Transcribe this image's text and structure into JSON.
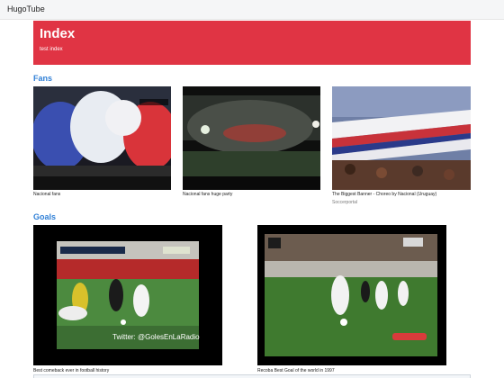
{
  "navbar": {
    "brand": "HugoTube"
  },
  "hero": {
    "title": "Index",
    "subtitle": "test index",
    "color": "#e03444"
  },
  "sections": [
    {
      "title": "Fans",
      "videos": [
        {
          "title": "Nacional fans",
          "source": ""
        },
        {
          "title": "Nacional fans huge party",
          "source": ""
        },
        {
          "title": "The Biggest Banner - Choreo by Nacional (Uruguay)",
          "source": "Soccerportal"
        }
      ]
    },
    {
      "title": "Goals",
      "videos": [
        {
          "title": "Best comeback ever in football history",
          "overlay": "Twitter: @GolesEnLaRadio",
          "source": ""
        },
        {
          "title": "Recoba Best Goal of the world in 1997",
          "source": ""
        }
      ]
    }
  ],
  "colors": {
    "accent": "#2f7fd6",
    "navbar_bg": "#f5f6f7"
  }
}
